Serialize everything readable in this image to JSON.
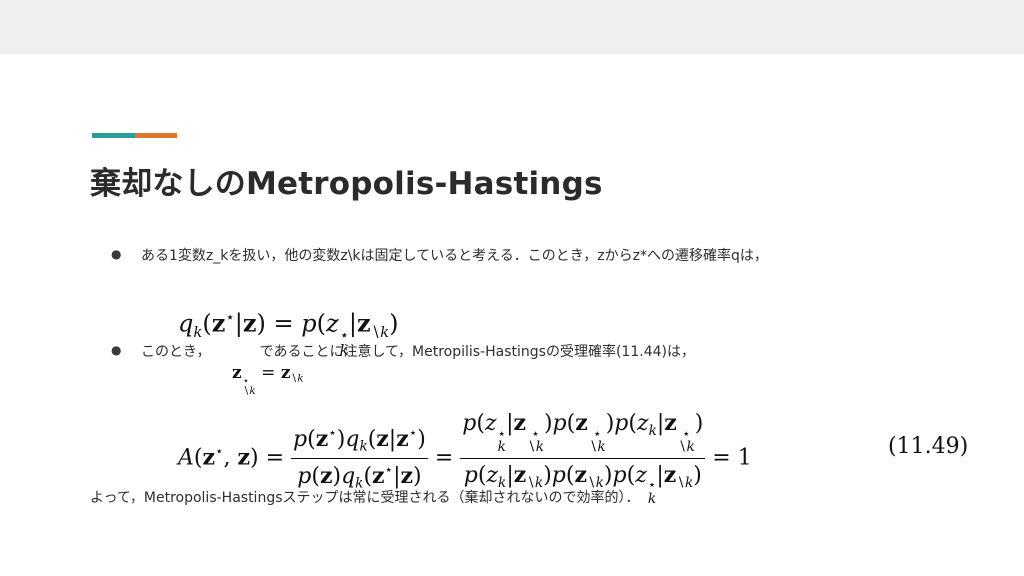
{
  "colors": {
    "top_band": "#efefef",
    "accent_teal": "#2a9d96",
    "accent_orange": "#e0762b",
    "title_text": "#2b2b2b",
    "body_text": "#2e2e2e"
  },
  "title": "棄却なしのMetropolis-Hastings",
  "bullets": [
    {
      "marker": "●",
      "text": "ある1変数z_kを扱い，他の変数z\\kは固定していると考える．このとき，zからz*への遷移確率qは，"
    },
    {
      "marker": "●",
      "text": "このとき，　　　　であることに注意して，Metropilis-Hastingsの受理確率(11.44)は，"
    }
  ],
  "equation_number": "(11.49)",
  "closing_text": "よって，Metropolis-Hastingsステップは常に受理される（棄却されないので効率的）．"
}
